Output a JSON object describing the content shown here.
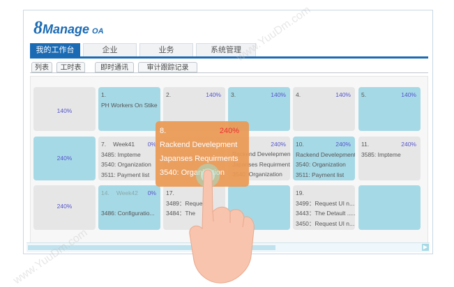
{
  "logo": {
    "digit": "8",
    "name": "Manage",
    "suffix": "OA"
  },
  "tabs": [
    {
      "label": "我的工作台"
    },
    {
      "label": "企业"
    },
    {
      "label": "业务"
    },
    {
      "label": "系统管理"
    }
  ],
  "subtabs": [
    {
      "label": "列表"
    },
    {
      "label": "工时表"
    },
    {
      "label": "即时通讯"
    },
    {
      "label": "审计跟踪记录"
    }
  ],
  "cells": {
    "c1": {
      "pct": "140%"
    },
    "c2": {
      "num": "1.",
      "line1": "PH Workers On Stike"
    },
    "c3": {
      "num": "2.",
      "pct": "140%"
    },
    "c4": {
      "num": "3.",
      "pct": "140%"
    },
    "c5": {
      "num": "4.",
      "pct": "140%"
    },
    "c6": {
      "num": "5.",
      "pct": "140%"
    },
    "c7": {
      "pct": "240%"
    },
    "c8": {
      "num": "7.",
      "week": "Week41",
      "pct": "0%",
      "line1": "3485: Impteme",
      "line2": "3540: Organization",
      "line3": "3511: Payment list"
    },
    "c9": {
      "pct": "240%",
      "line1": "Rackend Develepment",
      "line2": "Japanses Requirments",
      "line3": "3540: Organization"
    },
    "c10": {
      "num": "10.",
      "pct": "240%",
      "line1": "Rackend Develepment",
      "line2": "3540: Organization",
      "line3": "3511: Payment list"
    },
    "c11": {
      "num": "11.",
      "pct": "240%",
      "line1": "3585: Impteme"
    },
    "c12": {
      "pct": "240%"
    },
    "c13": {
      "num": "14.",
      "week": "Week42",
      "pct": "0%",
      "line1": "3486: Configuratio..."
    },
    "c14": {
      "num": "17.",
      "line1": "3489：Request",
      "line2": "3484：The"
    },
    "c15": {
      "num": "19.",
      "line1": "3499：Request UI n.....",
      "line2": "3443：The Detault .....",
      "line3": "3450：Request UI n....."
    }
  },
  "highlight": {
    "num": "8.",
    "pct": "240%",
    "line1": "Rackend Develepment",
    "line2": "Japanses Requirments",
    "line3": "3540: Organization"
  },
  "watermark": {
    "text": "www.YuuDm.com"
  },
  "colors": {
    "brand": "#1b6bb4",
    "cell_blue": "#a6d9e6",
    "cell_gray": "#e6e6e6",
    "highlight": "#eb9a55",
    "pct_text": "#5555cc",
    "pct_alert": "#ee2222"
  }
}
